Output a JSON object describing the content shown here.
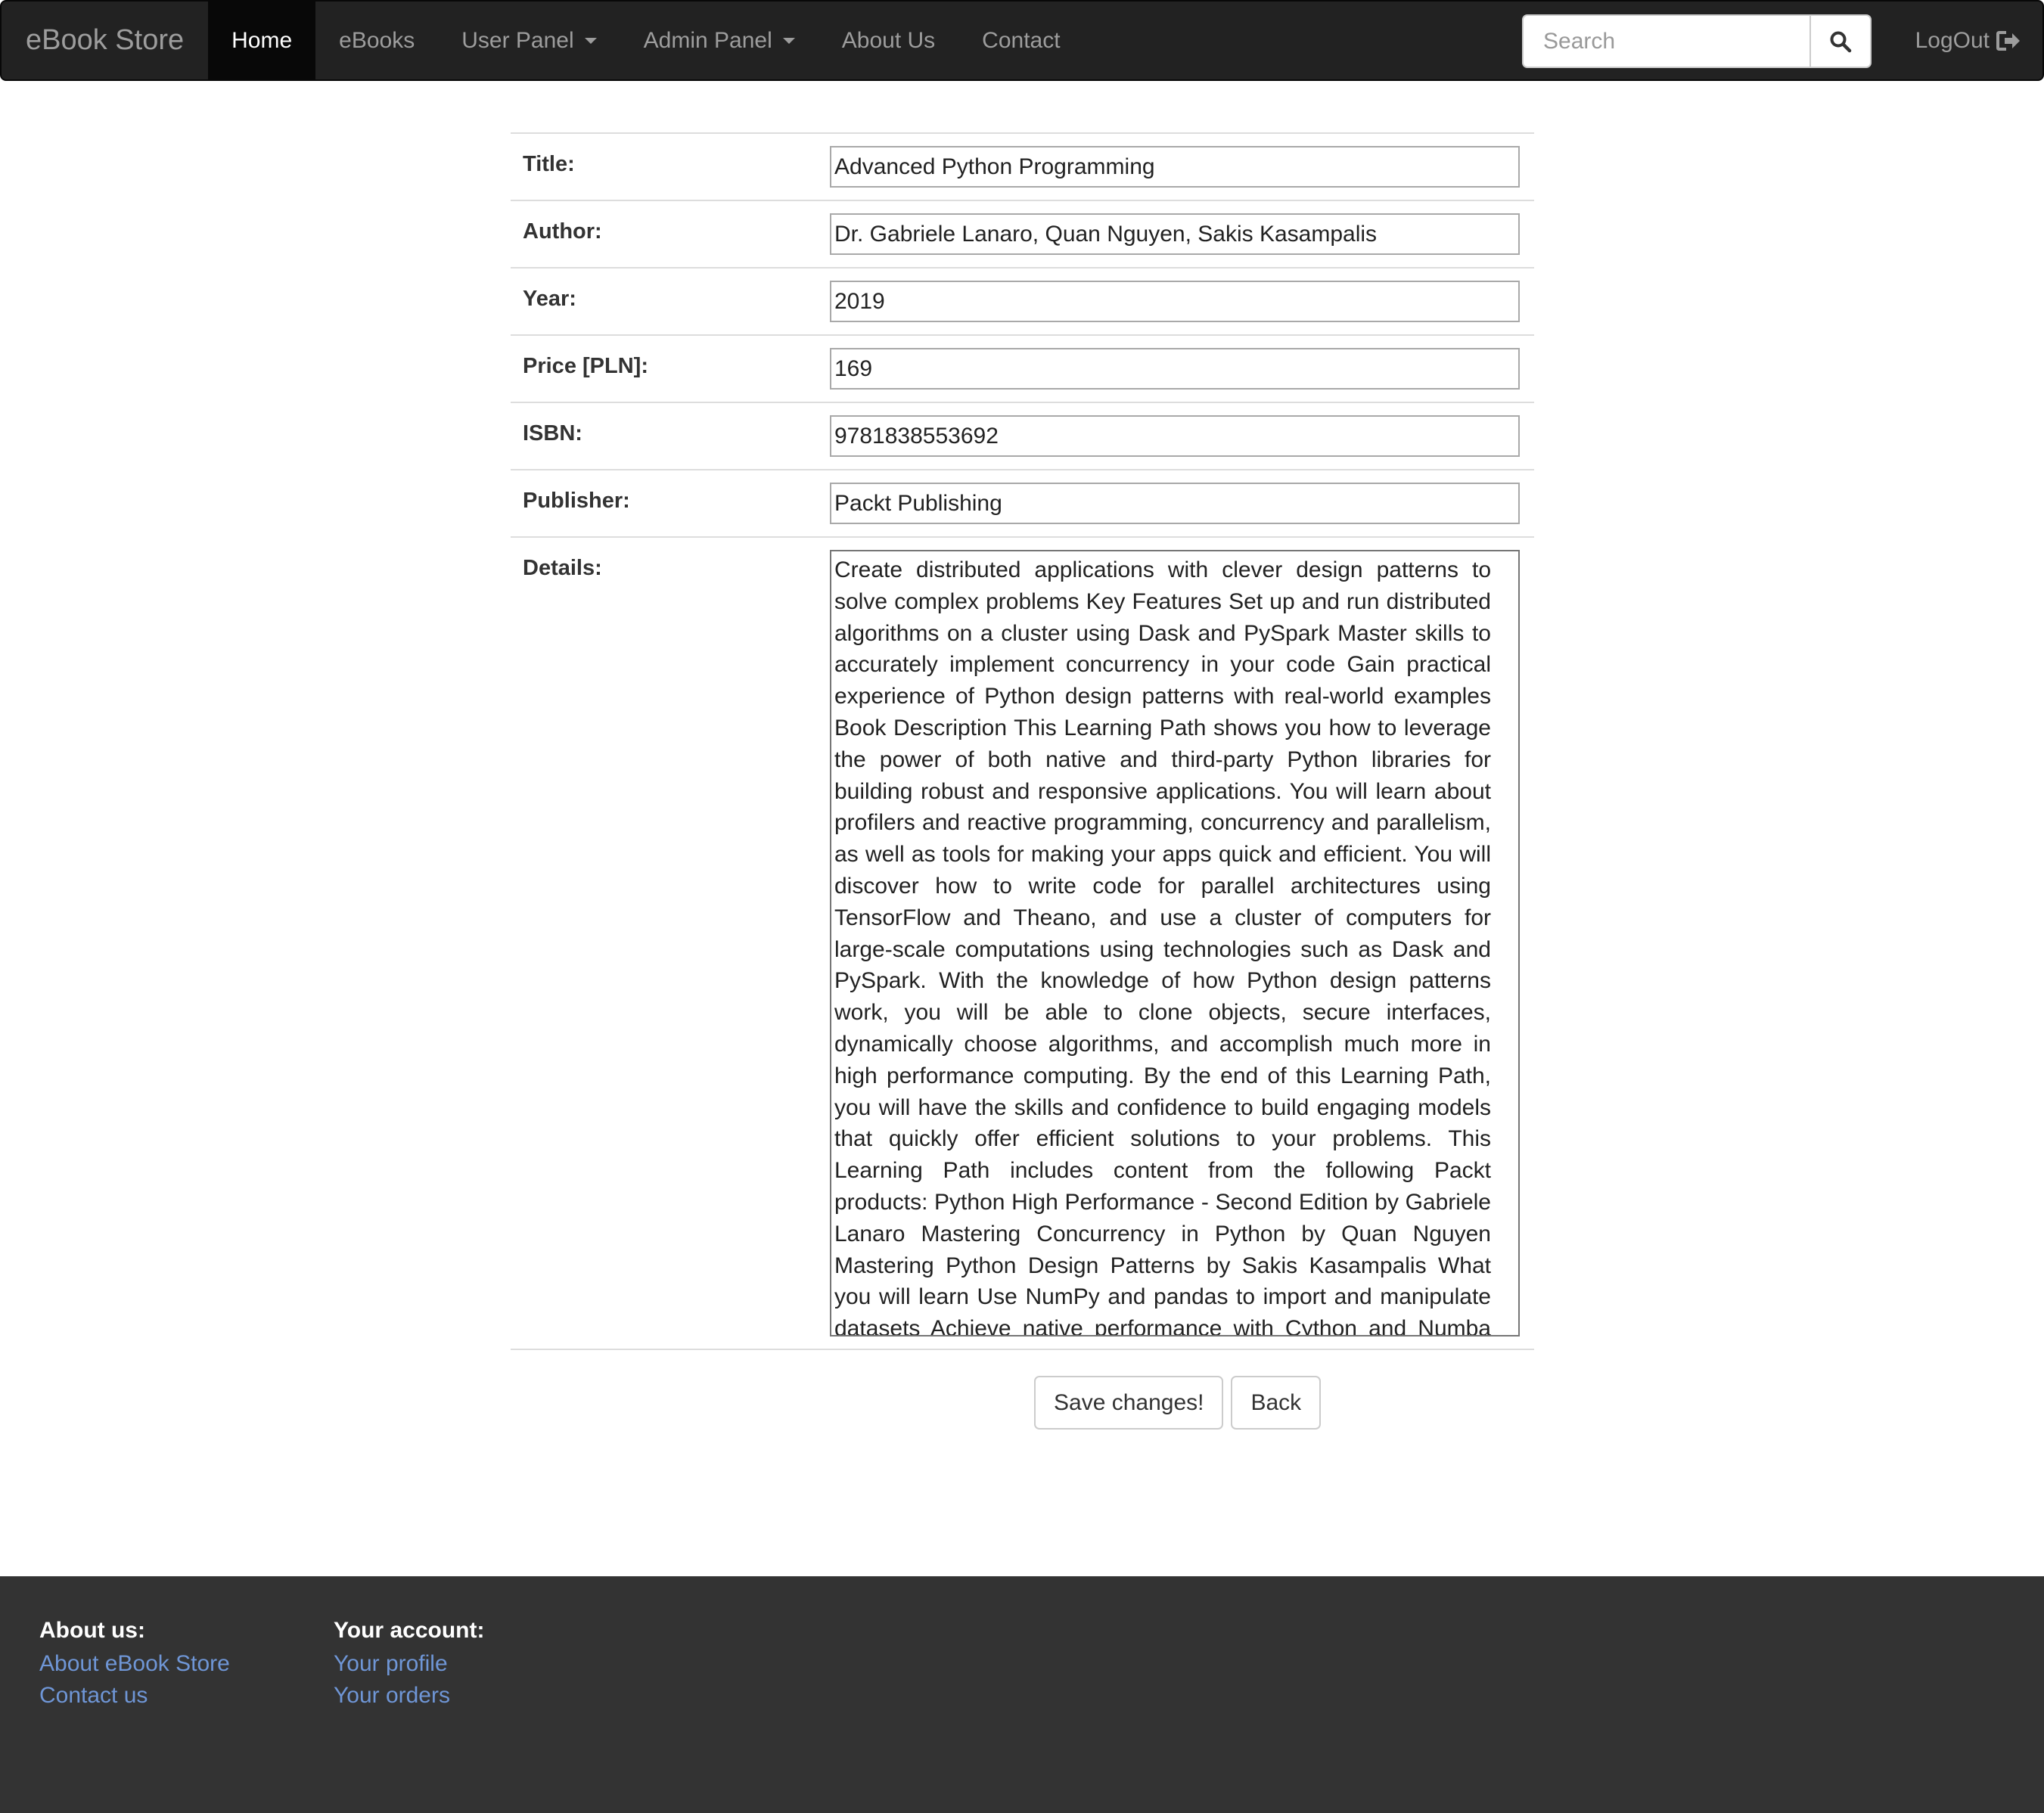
{
  "navbar": {
    "brand": "eBook Store",
    "items": [
      {
        "label": "Home",
        "active": true
      },
      {
        "label": "eBooks"
      },
      {
        "label": "User Panel",
        "dropdown": true
      },
      {
        "label": "Admin Panel",
        "dropdown": true
      },
      {
        "label": "About Us"
      },
      {
        "label": "Contact"
      }
    ],
    "search": {
      "placeholder": "Search",
      "icon": "search-icon"
    },
    "logout": {
      "label": "LogOut",
      "icon": "log-out-icon"
    }
  },
  "form": {
    "title": {
      "label": "Title:",
      "value": "Advanced Python Programming"
    },
    "author": {
      "label": "Author:",
      "value": "Dr. Gabriele Lanaro, Quan Nguyen, Sakis Kasampalis"
    },
    "year": {
      "label": "Year:",
      "value": "2019"
    },
    "price": {
      "label": "Price [PLN]:",
      "value": "169"
    },
    "isbn": {
      "label": "ISBN:",
      "value": "9781838553692"
    },
    "publisher": {
      "label": "Publisher:",
      "value": "Packt Publishing"
    },
    "details": {
      "label": "Details:",
      "value": "Create distributed applications with clever design patterns to solve complex problems Key Features Set up and run distributed algorithms on a cluster using Dask and PySpark Master skills to accurately implement concurrency in your code Gain practical experience of Python design patterns with real-world examples Book Description This Learning Path shows you how to leverage the power of both native and third-party Python libraries for building robust and responsive applications. You will learn about profilers and reactive programming, concurrency and parallelism, as well as tools for making your apps quick and efficient. You will discover how to write code for parallel architectures using TensorFlow and Theano, and use a cluster of computers for large-scale computations using technologies such as Dask and PySpark. With the knowledge of how Python design patterns work, you will be able to clone objects, secure interfaces, dynamically choose algorithms, and accomplish much more in high performance computing. By the end of this Learning Path, you will have the skills and confidence to build engaging models that quickly offer efficient solutions to your problems. This Learning Path includes content from the following Packt products: Python High Performance - Second Edition by Gabriele Lanaro Mastering Concurrency in Python by Quan Nguyen Mastering Python Design Patterns by Sakis Kasampalis What you will learn Use NumPy and pandas to import and manipulate datasets Achieve native performance with Cython and Numba Write"
    }
  },
  "buttons": {
    "save": "Save changes!",
    "back": "Back"
  },
  "footer": {
    "about": {
      "heading": "About us:",
      "links": [
        "About eBook Store",
        "Contact us"
      ]
    },
    "account": {
      "heading": "Your account:",
      "links": [
        "Your profile",
        "Your orders"
      ]
    }
  },
  "colors": {
    "navbar_bg": "#222222",
    "active_bg": "#080808",
    "footer_bg": "#333333",
    "link": "#6f96d6"
  }
}
